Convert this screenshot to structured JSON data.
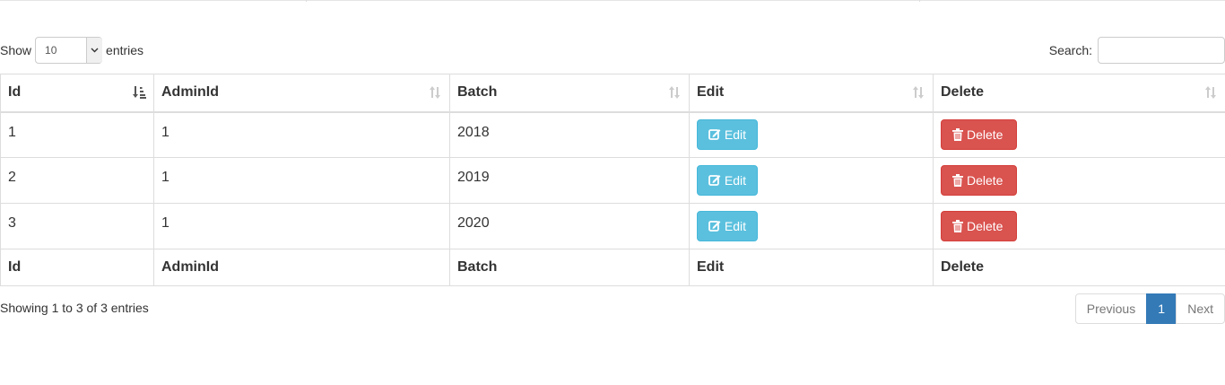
{
  "length": {
    "prefix": "Show",
    "value": "10",
    "suffix": "entries"
  },
  "search": {
    "label": "Search:",
    "value": "",
    "placeholder": ""
  },
  "table": {
    "columns": [
      "Id",
      "AdminId",
      "Batch",
      "Edit",
      "Delete"
    ],
    "sorted_column": "Id",
    "rows": [
      {
        "id": "1",
        "admin_id": "1",
        "batch": "2018",
        "edit_label": "Edit",
        "delete_label": "Delete"
      },
      {
        "id": "2",
        "admin_id": "1",
        "batch": "2019",
        "edit_label": "Edit",
        "delete_label": "Delete"
      },
      {
        "id": "3",
        "admin_id": "1",
        "batch": "2020",
        "edit_label": "Edit",
        "delete_label": "Delete"
      }
    ],
    "footer_columns": [
      "Id",
      "AdminId",
      "Batch",
      "Edit",
      "Delete"
    ]
  },
  "info": "Showing 1 to 3 of 3 entries",
  "pagination": {
    "previous": "Previous",
    "current": "1",
    "next": "Next"
  },
  "icons": {
    "edit": "edit-square-icon",
    "delete": "trash-icon",
    "sort_active": "sort-ascending-icon",
    "sort_inactive": "sort-both-icon",
    "select_arrow": "chevron-down-icon"
  },
  "colors": {
    "edit_button": "#5bc0de",
    "delete_button": "#d9534f",
    "pagination_active": "#337ab7"
  }
}
